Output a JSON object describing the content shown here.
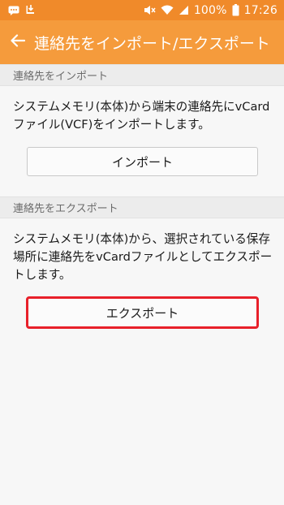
{
  "status_bar": {
    "battery_percent": "100%",
    "time": "17:26",
    "icons": [
      "message-icon",
      "download-icon",
      "mute-icon",
      "wifi-icon",
      "signal-icon",
      "battery-icon"
    ]
  },
  "app_bar": {
    "back_icon": "arrow-left-icon",
    "title": "連絡先をインポート/エクスポート"
  },
  "import_section": {
    "header": "連絡先をインポート",
    "description": "システムメモリ(本体)から端末の連絡先にvCardファイル(VCF)をインポートします。",
    "button_label": "インポート"
  },
  "export_section": {
    "header": "連絡先をエクスポート",
    "description": "システムメモリ(本体)から、選択されている保存場所に連絡先をvCardファイルとしてエクスポートします。",
    "button_label": "エクスポート"
  },
  "colors": {
    "status_bar": "#f08a2a",
    "app_bar": "#f59b3c",
    "highlight": "#e8202a"
  }
}
